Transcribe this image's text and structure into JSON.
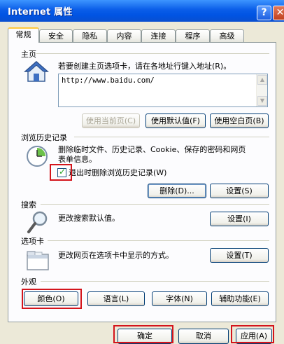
{
  "window": {
    "title": "Internet 属性",
    "help_label": "?",
    "close_label": "✕"
  },
  "tabs": [
    "常规",
    "安全",
    "隐私",
    "内容",
    "连接",
    "程序",
    "高级"
  ],
  "home": {
    "group_label": "主页",
    "description": "若要创建主页选项卡，请在各地址行键入地址(R)。",
    "url": "http://www.baidu.com/",
    "btn_current": "使用当前页(C)",
    "btn_default": "使用默认值(F)",
    "btn_blank": "使用空白页(B)"
  },
  "history": {
    "group_label": "浏览历史记录",
    "description_line1": "删除临时文件、历史记录、Cookie、保存的密码和网页",
    "description_line2": "表单信息。",
    "checkbox_label": "退出时删除浏览历史记录(W)",
    "checkbox_checked": true,
    "btn_delete": "删除(D)...",
    "btn_settings": "设置(S)"
  },
  "search": {
    "group_label": "搜索",
    "description": "更改搜索默认值。",
    "btn_settings": "设置(I)"
  },
  "tabs_section": {
    "group_label": "选项卡",
    "description": "更改网页在选项卡中显示的方式。",
    "btn_settings": "设置(T)"
  },
  "appearance": {
    "group_label": "外观",
    "btn_colors": "颜色(O)",
    "btn_languages": "语言(L)",
    "btn_fonts": "字体(N)",
    "btn_accessibility": "辅助功能(E)"
  },
  "footer": {
    "btn_ok": "确定",
    "btn_cancel": "取消",
    "btn_apply": "应用(A)"
  },
  "colors": {
    "title_bar": "#0054E3",
    "dialog_bg": "#ECE9D8",
    "highlight_box": "#D4141B"
  }
}
